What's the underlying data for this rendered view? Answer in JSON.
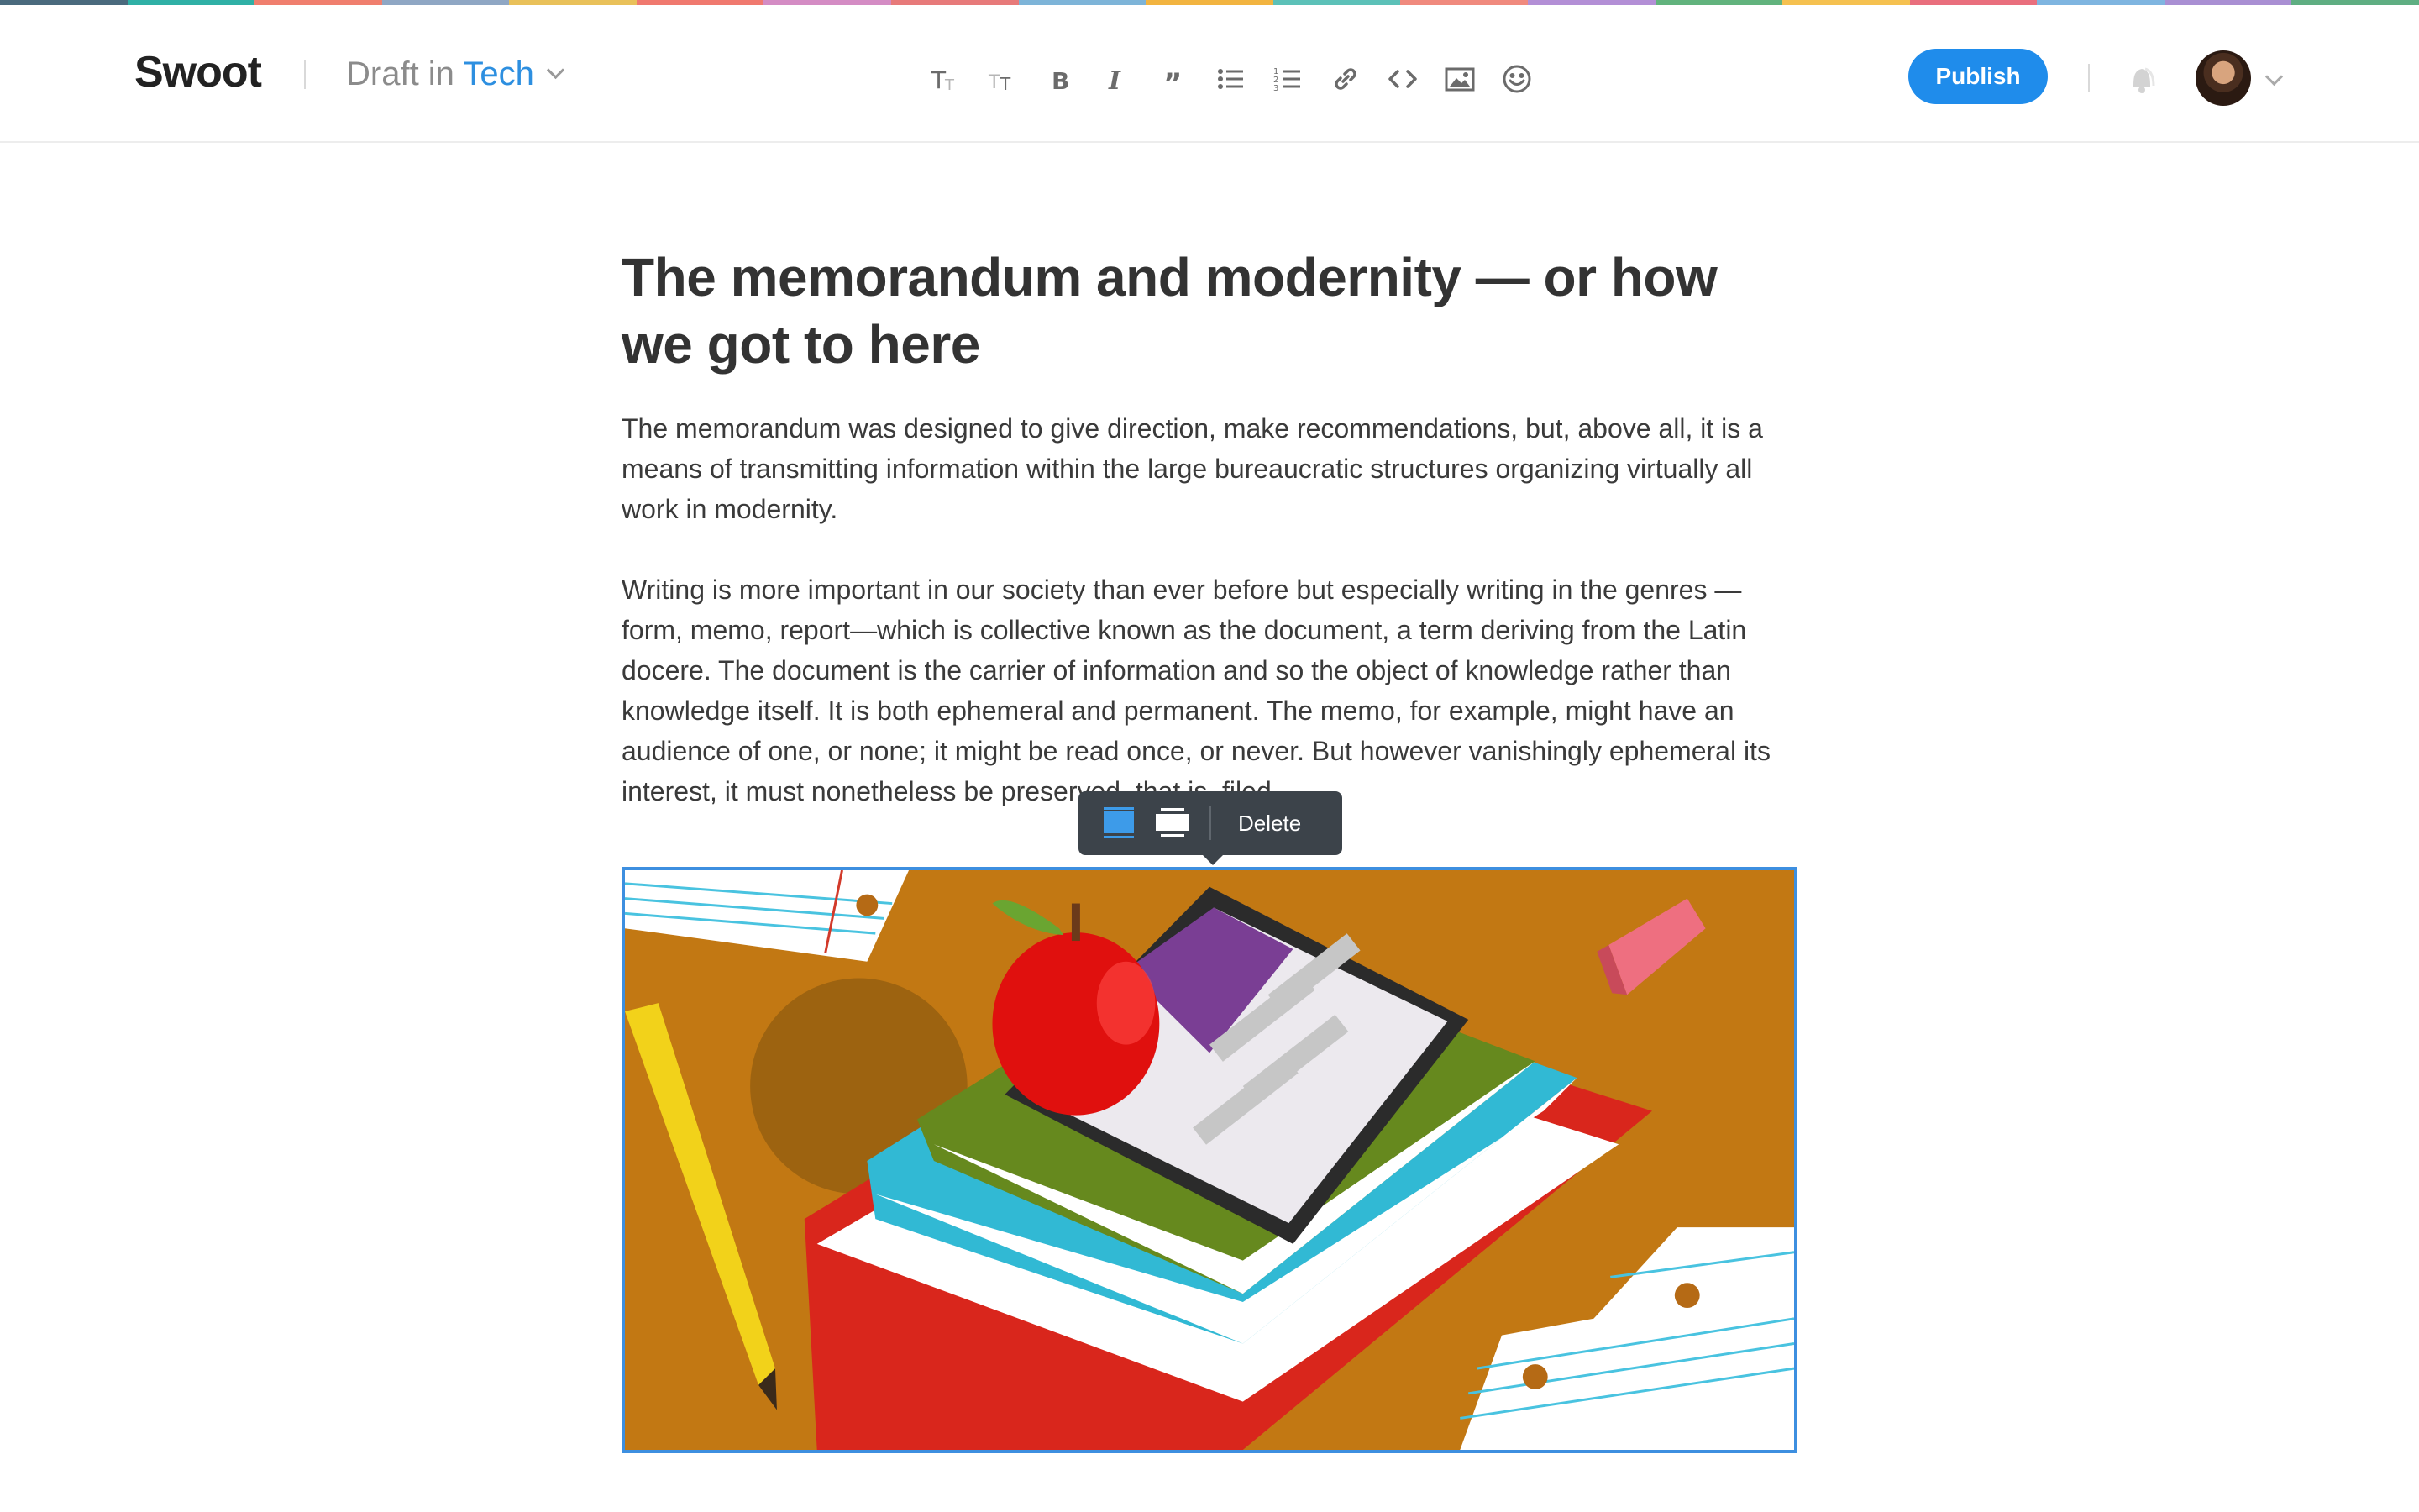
{
  "colors": {
    "accent": "#1f8ceb",
    "category": "#2d8fe0",
    "rainbow": [
      "#4a6a7d",
      "#2fb0a6",
      "#f07f6e",
      "#8fa7c4",
      "#e9c15a",
      "#f0796f",
      "#d48cc4",
      "#e77a7a",
      "#7db4d8",
      "#f2b440",
      "#5cc1b8",
      "#f08a7e",
      "#b38fd6",
      "#62b37d",
      "#f5c150",
      "#e96f7d",
      "#7fb5e0",
      "#a98fd3",
      "#5fae82"
    ]
  },
  "header": {
    "logo": "Swoot",
    "draft_prefix": "Draft in",
    "category": "Tech",
    "toolbar": [
      {
        "name": "heading-icon"
      },
      {
        "name": "subheading-icon"
      },
      {
        "name": "bold-icon"
      },
      {
        "name": "italic-icon"
      },
      {
        "name": "quote-icon"
      },
      {
        "name": "bulleted-list-icon"
      },
      {
        "name": "numbered-list-icon"
      },
      {
        "name": "link-icon"
      },
      {
        "name": "code-icon"
      },
      {
        "name": "image-icon"
      },
      {
        "name": "emoji-icon"
      }
    ],
    "publish_label": "Publish"
  },
  "article": {
    "title": "The memorandum and modernity — or how we got to here",
    "paragraphs": [
      "The memorandum was designed to give direction, make recommendations, but, above all, it is a means of transmitting information within the large bureaucratic structures organizing virtually all work in modernity.",
      "Writing is more important in our society than ever before but especially writing in the genres —form, memo, report—which is collective known as the document, a term deriving from the Latin docere. The document is the carrier of information and so the object of knowledge rather than knowledge itself. It is both ephemeral and permanent. The memo, for example, might have an audience of one, or none; it might be read once, or never. But however vanishingly ephemeral its interest, it must nonetheless be preserved, that is, filed."
    ]
  },
  "image_toolbar": {
    "delete_label": "Delete"
  }
}
